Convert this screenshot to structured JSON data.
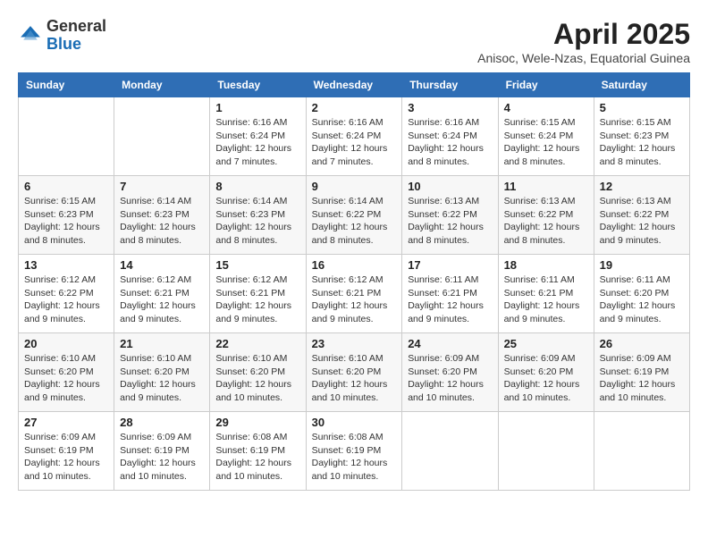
{
  "header": {
    "logo": {
      "general": "General",
      "blue": "Blue"
    },
    "title": "April 2025",
    "location": "Anisoc, Wele-Nzas, Equatorial Guinea"
  },
  "weekdays": [
    "Sunday",
    "Monday",
    "Tuesday",
    "Wednesday",
    "Thursday",
    "Friday",
    "Saturday"
  ],
  "weeks": [
    [
      {
        "day": "",
        "info": ""
      },
      {
        "day": "",
        "info": ""
      },
      {
        "day": "1",
        "info": "Sunrise: 6:16 AM\nSunset: 6:24 PM\nDaylight: 12 hours and 7 minutes."
      },
      {
        "day": "2",
        "info": "Sunrise: 6:16 AM\nSunset: 6:24 PM\nDaylight: 12 hours and 7 minutes."
      },
      {
        "day": "3",
        "info": "Sunrise: 6:16 AM\nSunset: 6:24 PM\nDaylight: 12 hours and 8 minutes."
      },
      {
        "day": "4",
        "info": "Sunrise: 6:15 AM\nSunset: 6:24 PM\nDaylight: 12 hours and 8 minutes."
      },
      {
        "day": "5",
        "info": "Sunrise: 6:15 AM\nSunset: 6:23 PM\nDaylight: 12 hours and 8 minutes."
      }
    ],
    [
      {
        "day": "6",
        "info": "Sunrise: 6:15 AM\nSunset: 6:23 PM\nDaylight: 12 hours and 8 minutes."
      },
      {
        "day": "7",
        "info": "Sunrise: 6:14 AM\nSunset: 6:23 PM\nDaylight: 12 hours and 8 minutes."
      },
      {
        "day": "8",
        "info": "Sunrise: 6:14 AM\nSunset: 6:23 PM\nDaylight: 12 hours and 8 minutes."
      },
      {
        "day": "9",
        "info": "Sunrise: 6:14 AM\nSunset: 6:22 PM\nDaylight: 12 hours and 8 minutes."
      },
      {
        "day": "10",
        "info": "Sunrise: 6:13 AM\nSunset: 6:22 PM\nDaylight: 12 hours and 8 minutes."
      },
      {
        "day": "11",
        "info": "Sunrise: 6:13 AM\nSunset: 6:22 PM\nDaylight: 12 hours and 8 minutes."
      },
      {
        "day": "12",
        "info": "Sunrise: 6:13 AM\nSunset: 6:22 PM\nDaylight: 12 hours and 9 minutes."
      }
    ],
    [
      {
        "day": "13",
        "info": "Sunrise: 6:12 AM\nSunset: 6:22 PM\nDaylight: 12 hours and 9 minutes."
      },
      {
        "day": "14",
        "info": "Sunrise: 6:12 AM\nSunset: 6:21 PM\nDaylight: 12 hours and 9 minutes."
      },
      {
        "day": "15",
        "info": "Sunrise: 6:12 AM\nSunset: 6:21 PM\nDaylight: 12 hours and 9 minutes."
      },
      {
        "day": "16",
        "info": "Sunrise: 6:12 AM\nSunset: 6:21 PM\nDaylight: 12 hours and 9 minutes."
      },
      {
        "day": "17",
        "info": "Sunrise: 6:11 AM\nSunset: 6:21 PM\nDaylight: 12 hours and 9 minutes."
      },
      {
        "day": "18",
        "info": "Sunrise: 6:11 AM\nSunset: 6:21 PM\nDaylight: 12 hours and 9 minutes."
      },
      {
        "day": "19",
        "info": "Sunrise: 6:11 AM\nSunset: 6:20 PM\nDaylight: 12 hours and 9 minutes."
      }
    ],
    [
      {
        "day": "20",
        "info": "Sunrise: 6:10 AM\nSunset: 6:20 PM\nDaylight: 12 hours and 9 minutes."
      },
      {
        "day": "21",
        "info": "Sunrise: 6:10 AM\nSunset: 6:20 PM\nDaylight: 12 hours and 9 minutes."
      },
      {
        "day": "22",
        "info": "Sunrise: 6:10 AM\nSunset: 6:20 PM\nDaylight: 12 hours and 10 minutes."
      },
      {
        "day": "23",
        "info": "Sunrise: 6:10 AM\nSunset: 6:20 PM\nDaylight: 12 hours and 10 minutes."
      },
      {
        "day": "24",
        "info": "Sunrise: 6:09 AM\nSunset: 6:20 PM\nDaylight: 12 hours and 10 minutes."
      },
      {
        "day": "25",
        "info": "Sunrise: 6:09 AM\nSunset: 6:20 PM\nDaylight: 12 hours and 10 minutes."
      },
      {
        "day": "26",
        "info": "Sunrise: 6:09 AM\nSunset: 6:19 PM\nDaylight: 12 hours and 10 minutes."
      }
    ],
    [
      {
        "day": "27",
        "info": "Sunrise: 6:09 AM\nSunset: 6:19 PM\nDaylight: 12 hours and 10 minutes."
      },
      {
        "day": "28",
        "info": "Sunrise: 6:09 AM\nSunset: 6:19 PM\nDaylight: 12 hours and 10 minutes."
      },
      {
        "day": "29",
        "info": "Sunrise: 6:08 AM\nSunset: 6:19 PM\nDaylight: 12 hours and 10 minutes."
      },
      {
        "day": "30",
        "info": "Sunrise: 6:08 AM\nSunset: 6:19 PM\nDaylight: 12 hours and 10 minutes."
      },
      {
        "day": "",
        "info": ""
      },
      {
        "day": "",
        "info": ""
      },
      {
        "day": "",
        "info": ""
      }
    ]
  ]
}
